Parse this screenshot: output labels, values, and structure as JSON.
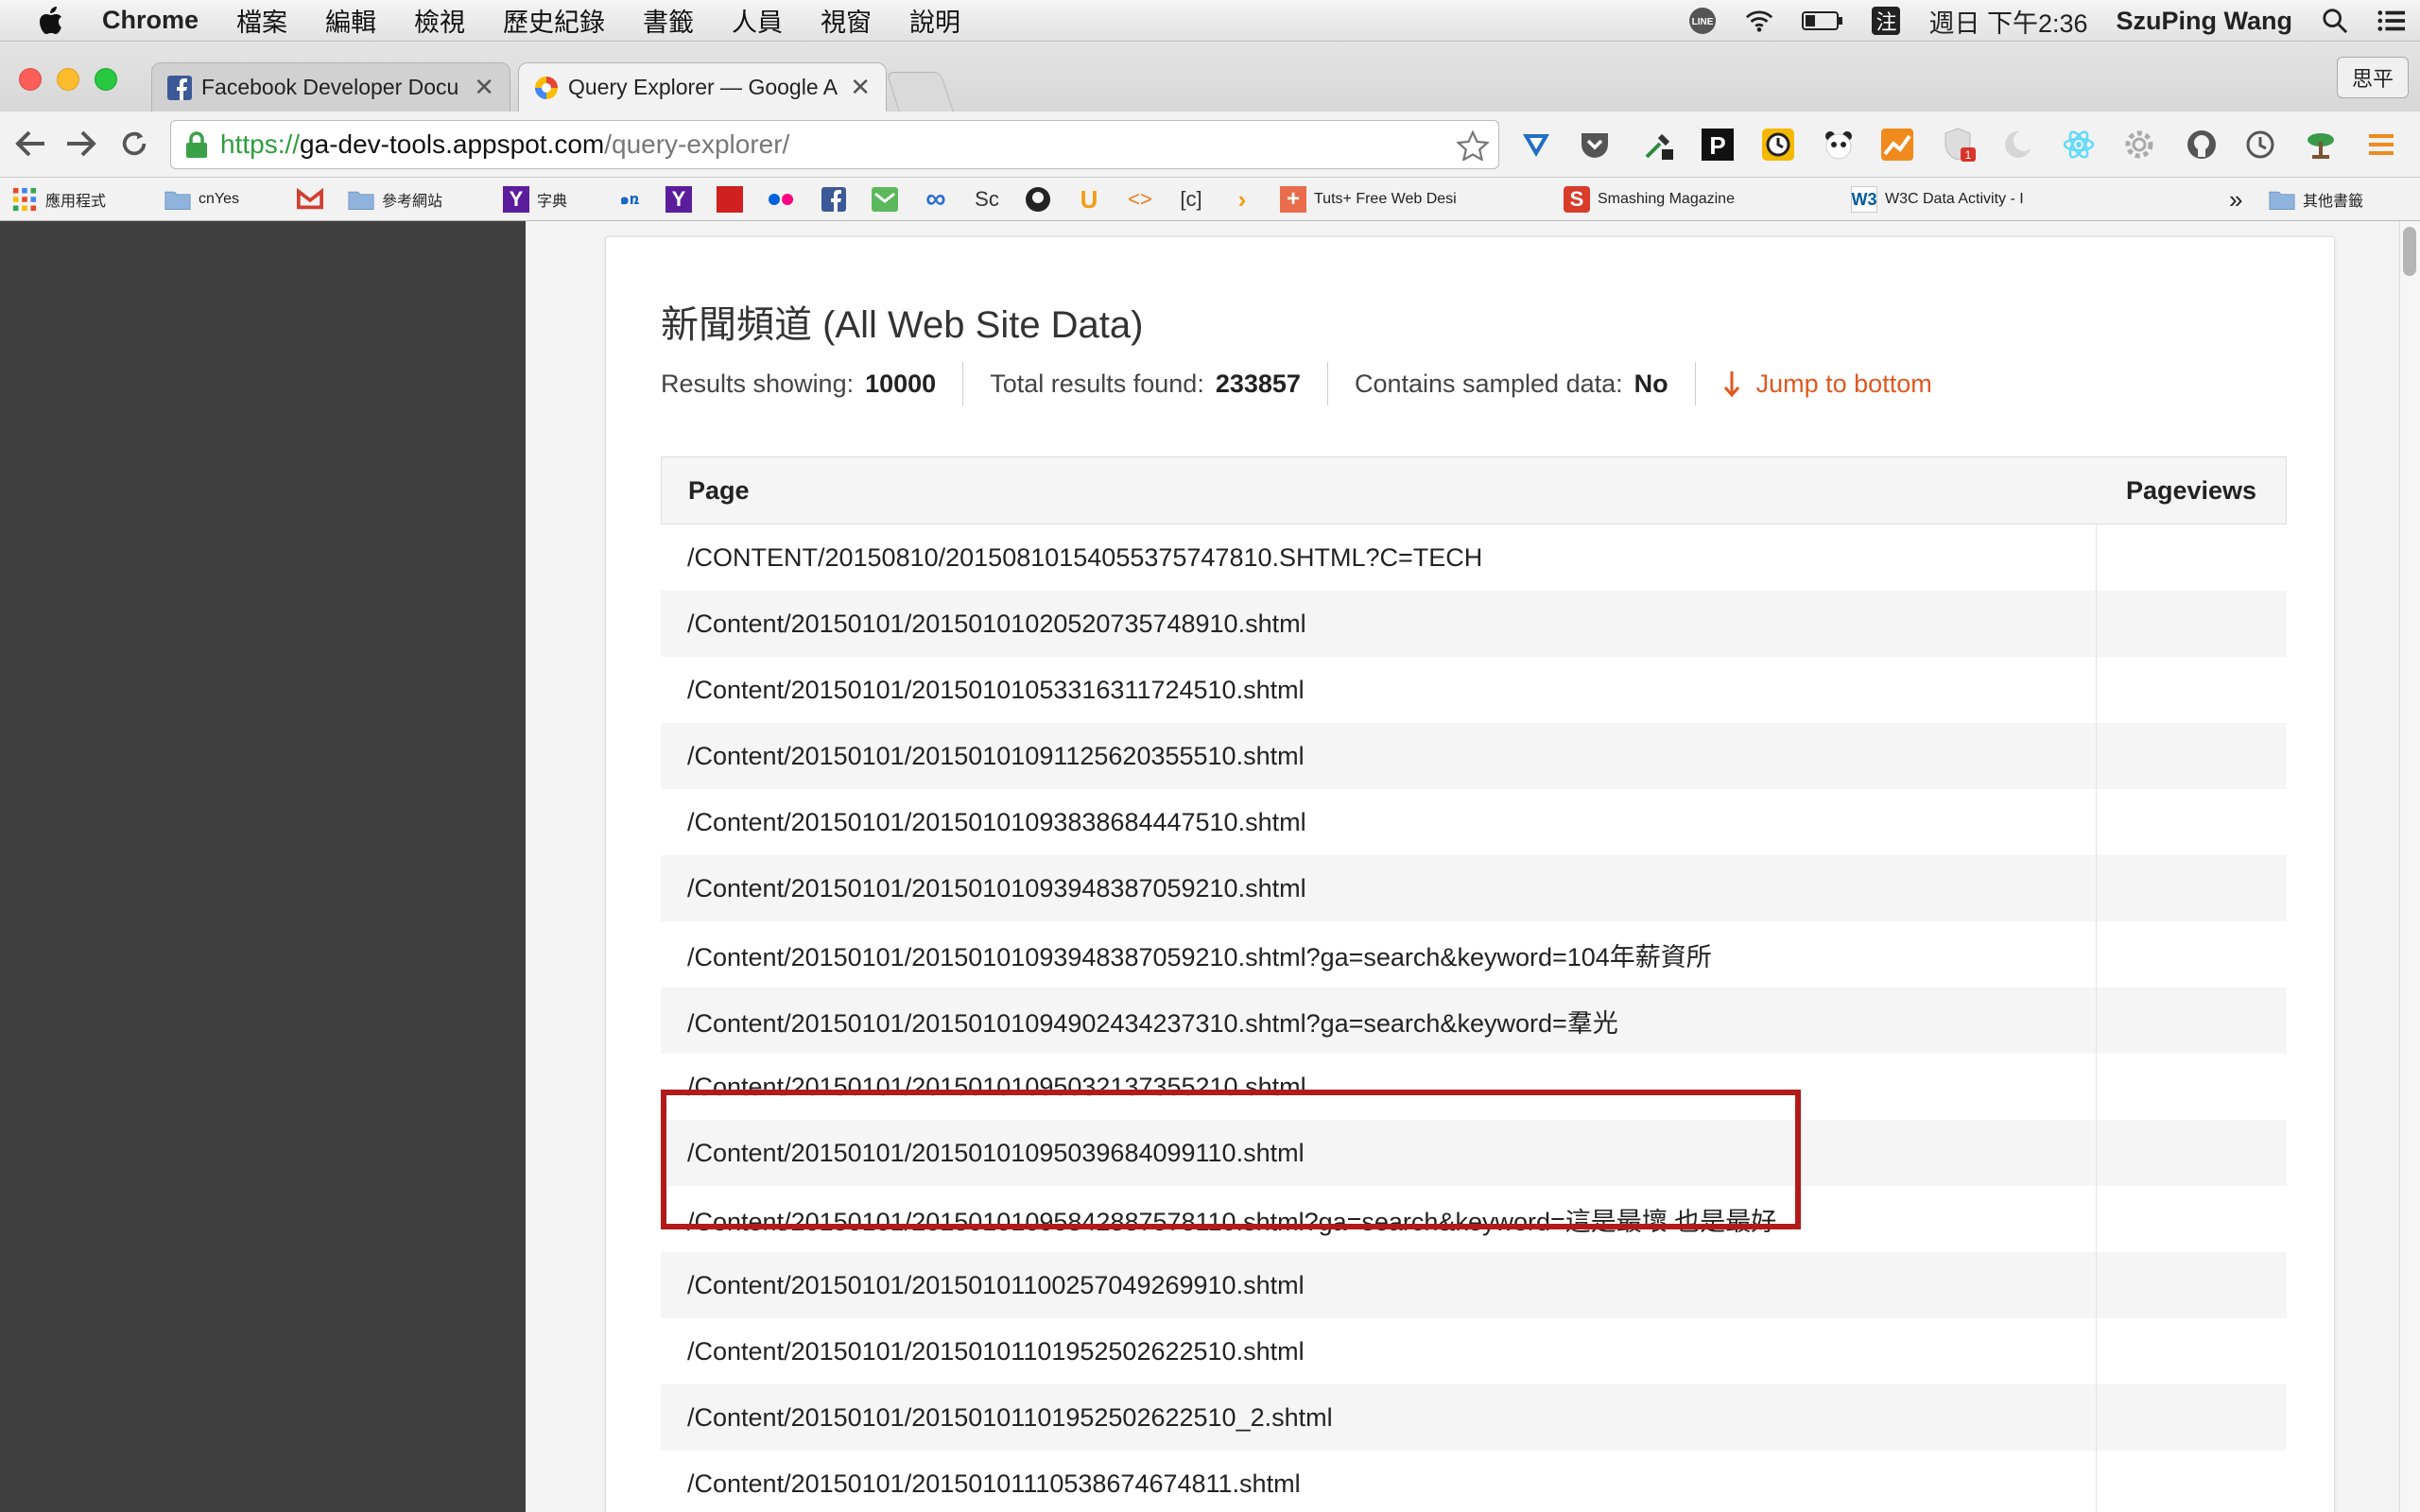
{
  "menubar": {
    "app_name": "Chrome",
    "menus": [
      "檔案",
      "編輯",
      "檢視",
      "歷史紀錄",
      "書籤",
      "人員",
      "視窗",
      "說明"
    ],
    "input_method": "注",
    "clock": "週日 下午2:36",
    "user": "SzuPing Wang"
  },
  "tabs": [
    {
      "title": "Facebook Developer Docu",
      "icon": "facebook-icon",
      "active": false
    },
    {
      "title": "Query Explorer — Google A",
      "icon": "google-analytics-icon",
      "active": true
    }
  ],
  "profile_button": "思平",
  "address_bar": {
    "scheme": "https://",
    "host": "ga-dev-tools.appspot.com",
    "path": "/query-explorer/"
  },
  "bookmarks": [
    {
      "label": "應用程式",
      "icon": "apps-grid-icon"
    },
    {
      "label": "cnYes",
      "icon": "folder-icon"
    },
    {
      "label": "",
      "icon": "gmail-icon"
    },
    {
      "label": "參考網站",
      "icon": "folder-icon"
    },
    {
      "label": "字典",
      "icon": "yahoo-icon"
    },
    {
      "label": "",
      "icon": "bookmark-icon"
    },
    {
      "label": "",
      "icon": "yahoo-icon"
    },
    {
      "label": "",
      "icon": "bookmark-icon"
    },
    {
      "label": "",
      "icon": "flickr-icon"
    },
    {
      "label": "",
      "icon": "facebook-icon"
    },
    {
      "label": "",
      "icon": "mail-icon"
    },
    {
      "label": "",
      "icon": "infinity-icon"
    },
    {
      "label": "",
      "icon": "sc-icon"
    },
    {
      "label": "",
      "icon": "github-icon"
    },
    {
      "label": "",
      "icon": "u-icon"
    },
    {
      "label": "",
      "icon": "code-icon"
    },
    {
      "label": "",
      "icon": "c-icon"
    },
    {
      "label": "",
      "icon": "arrow-icon"
    },
    {
      "label": "Tuts+ Free Web Desi",
      "icon": "tutsplus-icon"
    },
    {
      "label": "Smashing Magazine",
      "icon": "smashing-icon"
    },
    {
      "label": "W3C Data Activity - I",
      "icon": "w3c-icon"
    },
    {
      "label": "»",
      "icon": ""
    },
    {
      "label": "其他書籤",
      "icon": "folder-icon"
    }
  ],
  "report": {
    "title": "新聞頻道 (All Web Site Data)",
    "results_label": "Results showing:",
    "results_value": "10000",
    "total_label": "Total results found:",
    "total_value": "233857",
    "sampled_label": "Contains sampled data:",
    "sampled_value": "No",
    "jump_label": "Jump to bottom",
    "columns": [
      "Page",
      "Pageviews"
    ],
    "rows": [
      "/CONTENT/20150810/20150810154055375747810.SHTML?C=TECH",
      "/Content/20150101/20150101020520735748910.shtml",
      "/Content/20150101/20150101053316311724510.shtml",
      "/Content/20150101/20150101091125620355510.shtml",
      "/Content/20150101/20150101093838684447510.shtml",
      "/Content/20150101/20150101093948387059210.shtml",
      "/Content/20150101/20150101093948387059210.shtml?ga=search&keyword=104年薪資所",
      "/Content/20150101/20150101094902434237310.shtml?ga=search&keyword=羣光",
      "/Content/20150101/20150101095032137355210.shtml",
      "/Content/20150101/20150101095039684099110.shtml",
      "/Content/20150101/20150101095842887578110.shtml?ga=search&keyword=這是最壞 也是最好",
      "/Content/20150101/20150101100257049269910.shtml",
      "/Content/20150101/20150101101952502622510.shtml",
      "/Content/20150101/20150101101952502622510_2.shtml",
      "/Content/20150101/20150101110538674674811.shtml"
    ]
  },
  "colors": {
    "accent_orange": "#e0581f",
    "highlight_red": "#b31b1b",
    "sidebar_dark": "#3f3f3f",
    "url_green": "#2e9e3c"
  }
}
